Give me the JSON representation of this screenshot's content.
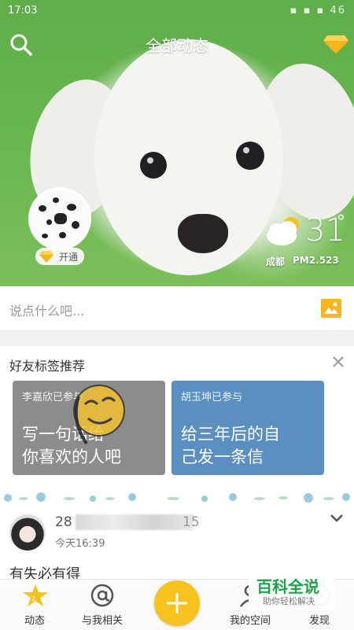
{
  "status_bar": {
    "time": "17:03",
    "indicators": "▪ ▪ ▪ 46"
  },
  "header": {
    "title": "全部动态",
    "search_icon": "search-icon",
    "vip_icon": "diamond-icon"
  },
  "profile": {
    "open_badge": "开通"
  },
  "weather": {
    "temp": "31",
    "degree": "°",
    "city": "成都",
    "pm_label": "PM2.5",
    "pm_value": "23"
  },
  "compose": {
    "placeholder": "说点什么吧...",
    "photo_icon": "image-icon"
  },
  "recommend": {
    "title": "好友标签推荐",
    "cards": [
      {
        "participant": "李嘉欣已参与",
        "text_line1": "写一句话给",
        "text_line2": "你喜欢的人吧"
      },
      {
        "participant": "胡玉坤已参与",
        "text_line1": "给三年后的自",
        "text_line2": "己发一条信"
      }
    ]
  },
  "feed": {
    "name": "28",
    "name_suffix": "15",
    "time": "今天16:39",
    "text": "有失必有得"
  },
  "watermark": {
    "logo": "百科全说",
    "sub": "助你轻松解决"
  },
  "tabbar": {
    "items": [
      {
        "label": "动态"
      },
      {
        "label": "与我相关"
      },
      {
        "label": ""
      },
      {
        "label": "我的空间"
      },
      {
        "label": "发现"
      }
    ]
  },
  "colors": {
    "accent": "#f8c21c",
    "card_blue": "#5b8fc2",
    "card_gray": "#8c8c8c",
    "hero_green": "#66b54e"
  }
}
